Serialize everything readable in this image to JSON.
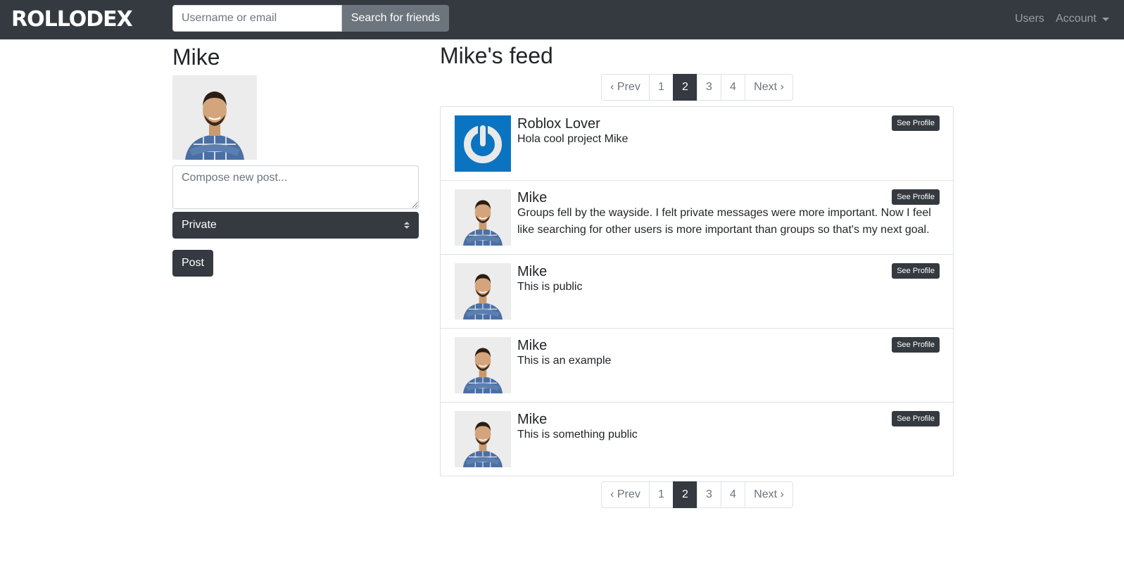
{
  "navbar": {
    "brand": "ROLLODEX",
    "search_placeholder": "Username or email",
    "search_button": "Search for friends",
    "users_link": "Users",
    "account_link": "Account"
  },
  "profile": {
    "name": "Mike",
    "avatar": "person-photo",
    "compose_placeholder": "Compose new post...",
    "privacy_selected": "Private",
    "post_button": "Post"
  },
  "feed": {
    "title": "Mike's feed",
    "pagination": {
      "prev": "‹ Prev",
      "pages": [
        "1",
        "2",
        "3",
        "4"
      ],
      "active": "2",
      "next": "Next ›"
    },
    "see_profile_label": "See Profile",
    "posts": [
      {
        "author": "Roblox Lover",
        "text": "Hola cool project Mike",
        "avatar": "power-logo"
      },
      {
        "author": "Mike",
        "text": "Groups fell by the wayside. I felt private messages were more important. Now I feel like searching for other users is more important than groups so that's my next goal.",
        "avatar": "person-photo"
      },
      {
        "author": "Mike",
        "text": "This is public",
        "avatar": "person-photo"
      },
      {
        "author": "Mike",
        "text": "This is an example",
        "avatar": "person-photo"
      },
      {
        "author": "Mike",
        "text": "This is something public",
        "avatar": "person-photo"
      }
    ]
  },
  "colors": {
    "navbar_bg": "#343a40",
    "secondary": "#6c757d",
    "logo_blue": "#0b74c1"
  }
}
